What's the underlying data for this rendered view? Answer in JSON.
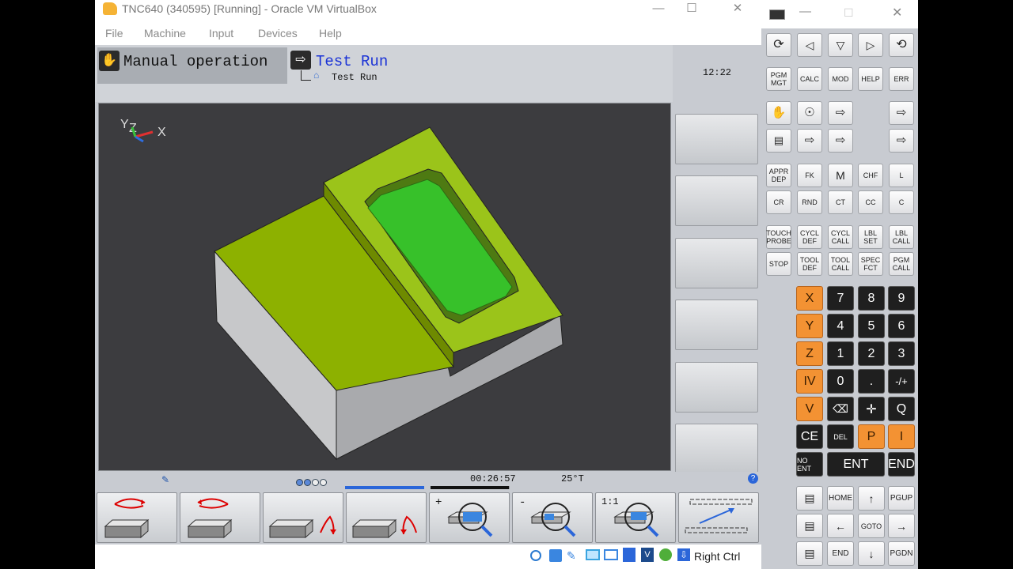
{
  "window": {
    "title": "TNC640 (340595) [Running] - Oracle VM VirtualBox",
    "menu": [
      "File",
      "Machine",
      "Input",
      "Devices",
      "Help"
    ]
  },
  "tnc": {
    "mode_left": "Manual operation",
    "mode_right": "Test Run",
    "mode_right_sub": "Test Run",
    "clock": "12:22",
    "axis_y": "Y",
    "axis_z": "Z",
    "axis_x": "X",
    "elapsed": "00:26:57",
    "angle": "25°T",
    "progress": 0.99,
    "softkeys": {
      "zoom_in": "+",
      "zoom_out": "-",
      "zoom_reset": "1:1"
    }
  },
  "host": {
    "right_ctrl": "Right Ctrl"
  },
  "keyboard": {
    "row_a": [
      "PGM MGT",
      "CALC",
      "MOD",
      "HELP",
      "ERR"
    ],
    "row_b1": [
      "APPR DEP",
      "FK",
      "M",
      "CHF",
      "L"
    ],
    "row_b2": [
      "CR",
      "RND",
      "CT",
      "CC",
      "C"
    ],
    "row_c1": [
      "TOUCH PROBE",
      "CYCL DEF",
      "CYCL CALL",
      "LBL SET",
      "LBL CALL"
    ],
    "row_c2": [
      "STOP",
      "TOOL DEF",
      "TOOL CALL",
      "SPEC FCT",
      "PGM CALL"
    ],
    "num_rows": [
      [
        "X",
        "7",
        "8",
        "9"
      ],
      [
        "Y",
        "4",
        "5",
        "6"
      ],
      [
        "Z",
        "1",
        "2",
        "3"
      ],
      [
        "IV",
        "0",
        ".",
        "-/+"
      ],
      [
        "V",
        "",
        "",
        "Q"
      ],
      [
        "CE",
        "DEL",
        "P",
        "I"
      ]
    ],
    "no_ent": "NO ENT",
    "ent": "ENT",
    "end": "END",
    "home": "HOME",
    "pgup": "PGUP",
    "goto": "GOTO",
    "end2": "END",
    "pgdn": "PGDN"
  }
}
